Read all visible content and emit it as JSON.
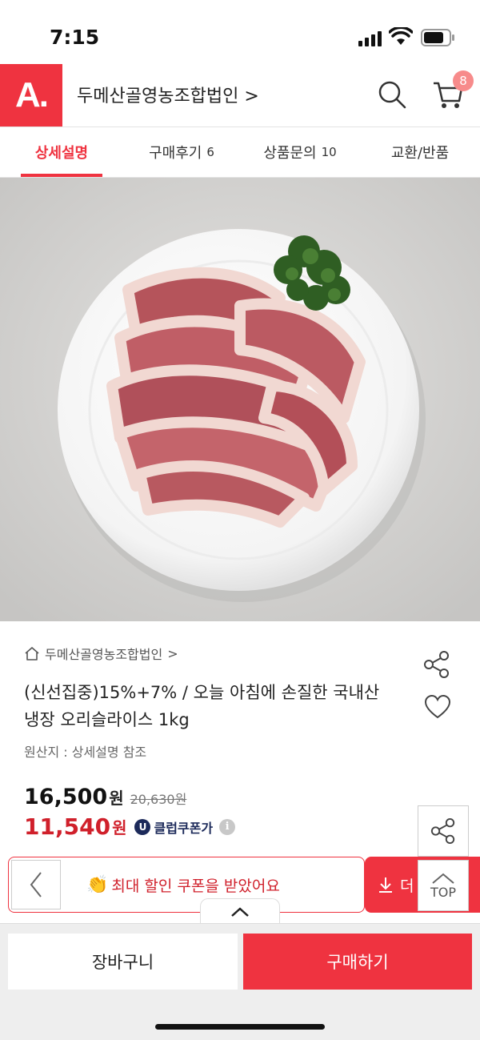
{
  "status_bar": {
    "time": "7:15"
  },
  "header": {
    "logo": "A.",
    "store_name": "두메산골영농조합법인",
    "store_chevron": ">",
    "cart_count": "8"
  },
  "tabs": [
    {
      "label": "상세설명",
      "count": ""
    },
    {
      "label": "구매후기",
      "count": "6"
    },
    {
      "label": "상품문의",
      "count": "10"
    },
    {
      "label": "교환/반품",
      "count": ""
    }
  ],
  "product": {
    "brand": "두메산골영농조합법인",
    "brand_chevron": ">",
    "title": "(신선집중)15%+7% / 오늘 아침에 손질한 국내산 냉장 오리슬라이스 1kg",
    "origin": "원산지 : 상세설명 참조",
    "price": "16,500",
    "price_unit": "원",
    "original_price": "20,630원",
    "sale_price": "11,540",
    "sale_unit": "원",
    "coupon_badge": "U",
    "coupon_label": "클럽쿠폰가",
    "info_icon": "i"
  },
  "floating": {
    "coupon_message": "최대 할인 쿠폰을 받았어요",
    "download_label": "더",
    "top_label": "TOP"
  },
  "bottom": {
    "cart_button": "장바구니",
    "buy_button": "구매하기"
  },
  "colors": {
    "brand_red": "#ef3340",
    "sale_red": "#d0202b",
    "coupon_navy": "#1c2a5a"
  },
  "icons": [
    "signal-icon",
    "wifi-icon",
    "battery-icon",
    "search-icon",
    "cart-icon",
    "home-icon",
    "share-icon",
    "heart-icon",
    "info-icon",
    "chevron-left-icon",
    "download-icon",
    "chevron-up-icon",
    "clap-icon"
  ]
}
